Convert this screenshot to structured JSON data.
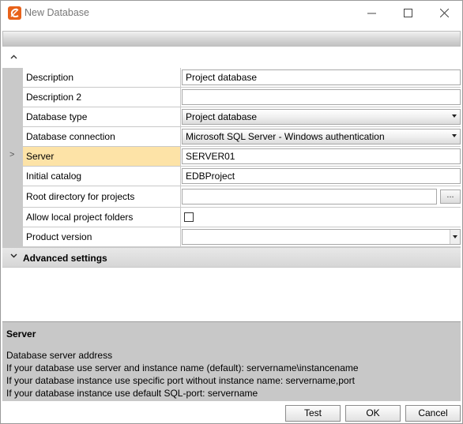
{
  "window": {
    "title": "New Database",
    "minimize_glyph": "—",
    "maximize_glyph": "☐",
    "close_glyph": "✕"
  },
  "grid": {
    "collapse_glyph": "^",
    "selected_row_marker": ">",
    "rows": [
      {
        "label": "Description",
        "value": "Project database",
        "kind": "text"
      },
      {
        "label": "Description 2",
        "value": "",
        "kind": "text"
      },
      {
        "label": "Database type",
        "value": "Project database",
        "kind": "dropdown"
      },
      {
        "label": "Database connection",
        "value": "Microsoft SQL Server - Windows authentication",
        "kind": "dropdown"
      },
      {
        "label": "Server",
        "value": "SERVER01",
        "kind": "text",
        "selected": true
      },
      {
        "label": "Initial catalog",
        "value": "EDBProject",
        "kind": "text"
      },
      {
        "label": "Root directory for projects",
        "value": "",
        "kind": "browse",
        "button_label": "..."
      },
      {
        "label": "Allow local project folders",
        "checked": false,
        "kind": "checkbox"
      },
      {
        "label": "Product version",
        "value": "",
        "kind": "dropdown"
      }
    ],
    "advanced": {
      "glyph": "v",
      "label": "Advanced settings"
    }
  },
  "help": {
    "title": "Server",
    "lines": [
      "Database server address",
      "If your database use server and instance name (default): servername\\instancename",
      "If your database instance use specific port without instance name: servername,port",
      "If your database instance use default SQL-port: servername"
    ]
  },
  "buttons": {
    "test": "Test",
    "ok": "OK",
    "cancel": "Cancel"
  },
  "colors": {
    "accent": "#e8621a",
    "selected_label": "#fde3a7",
    "gutter": "#c9c9c9",
    "help_bg": "#c8c8c8"
  },
  "icons": {
    "app": "app-logo-icon",
    "collapse": "chevron-up-icon",
    "expand": "chevron-down-icon",
    "row_pointer": "row-pointer-icon"
  }
}
